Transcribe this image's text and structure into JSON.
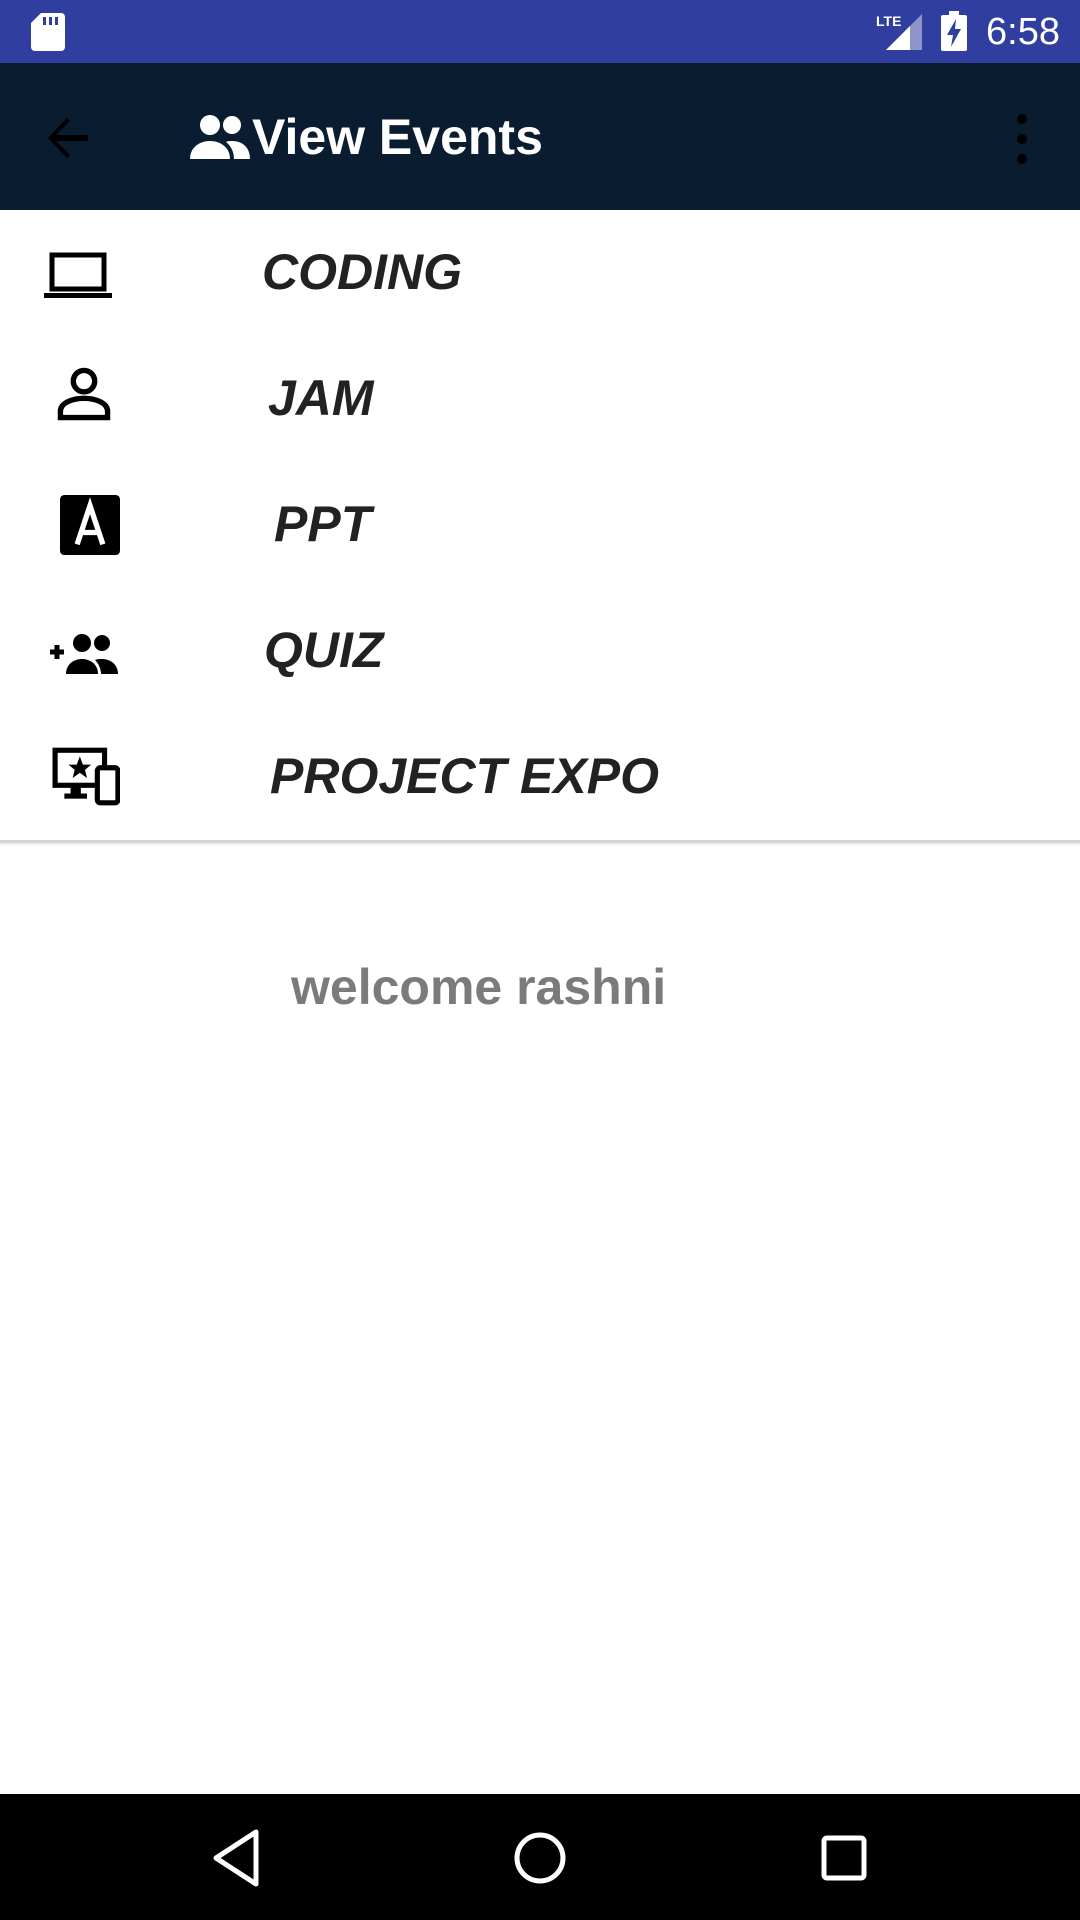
{
  "status_bar": {
    "time": "6:58",
    "network": "LTE",
    "background": "#303f9f",
    "icons": [
      "sd-card-icon",
      "signal-icon",
      "battery-charging-icon"
    ]
  },
  "app_bar": {
    "title": "View Events",
    "background": "#0a1c30",
    "icons": [
      "back-arrow-icon",
      "people-icon",
      "more-vert-icon"
    ]
  },
  "events": [
    {
      "label": "CODING",
      "icon": "laptop-icon"
    },
    {
      "label": "JAM",
      "icon": "person-icon"
    },
    {
      "label": "PPT",
      "icon": "font-a-icon"
    },
    {
      "label": "QUIZ",
      "icon": "group-add-icon"
    },
    {
      "label": "PROJECT EXPO",
      "icon": "devices-star-icon"
    }
  ],
  "welcome_text": "welcome rashni",
  "nav_bar": {
    "buttons": [
      "back-triangle-icon",
      "home-circle-icon",
      "recents-square-icon"
    ]
  }
}
